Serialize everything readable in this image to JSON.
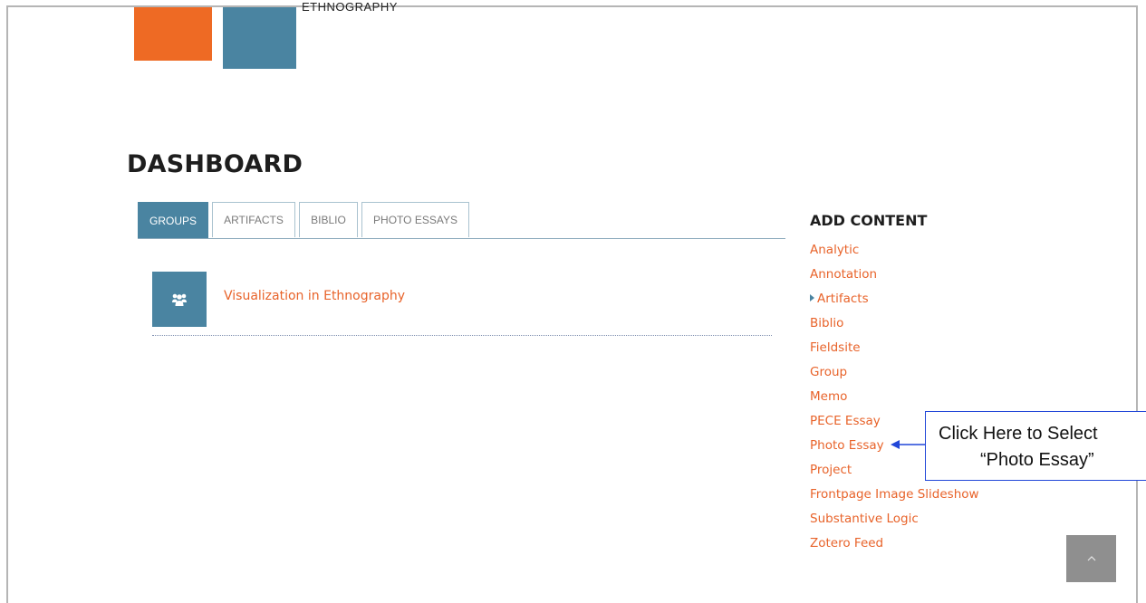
{
  "header": {
    "site_name_fragment": "ETHNOGRAPHY",
    "logo_colors": [
      "#ee6a24",
      "#4a84a1"
    ]
  },
  "page_title": "DASHBOARD",
  "tabs": [
    {
      "label": "GROUPS",
      "active": true
    },
    {
      "label": "ARTIFACTS",
      "active": false
    },
    {
      "label": "BIBLIO",
      "active": false
    },
    {
      "label": "PHOTO ESSAYS",
      "active": false
    }
  ],
  "groups": [
    {
      "name": "Visualization in Ethnography",
      "icon": "group-people-icon"
    }
  ],
  "add_content": {
    "heading": "ADD CONTENT",
    "items": [
      {
        "label": "Analytic"
      },
      {
        "label": "Annotation"
      },
      {
        "label": "Artifacts",
        "expandable": true
      },
      {
        "label": "Biblio"
      },
      {
        "label": "Fieldsite"
      },
      {
        "label": "Group"
      },
      {
        "label": "Memo"
      },
      {
        "label": "PECE Essay"
      },
      {
        "label": "Photo Essay"
      },
      {
        "label": "Project"
      },
      {
        "label": "Frontpage Image Slideshow"
      },
      {
        "label": "Substantive Logic"
      },
      {
        "label": "Zotero Feed"
      }
    ]
  },
  "callout": {
    "line1": "Click Here to Select",
    "line2": "“Photo Essay”"
  },
  "scroll_top": {
    "icon": "chevron-up-icon"
  },
  "colors": {
    "accent_orange": "#e8632a",
    "accent_blue": "#4a84a1",
    "callout_border": "#2147d8",
    "scroll_button": "#8f8f8f"
  }
}
